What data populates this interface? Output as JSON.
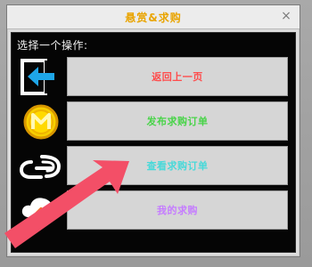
{
  "dialog": {
    "title": "悬赏&求购",
    "close_label": "×",
    "prompt": "选择一个操作:"
  },
  "actions": [
    {
      "label": "返回上一页",
      "color": "#ff4b4b",
      "icon": "back-arrow-icon"
    },
    {
      "label": "发布求购订单",
      "color": "#48d448",
      "icon": "coin-m-icon"
    },
    {
      "label": "查看求购订单",
      "color": "#48d9d9",
      "icon": "link-chain-icon"
    },
    {
      "label": "我的求购",
      "color": "#c57cff",
      "icon": "cloud-upload-icon"
    }
  ],
  "annotation": {
    "arrow_color": "#f34f67"
  }
}
